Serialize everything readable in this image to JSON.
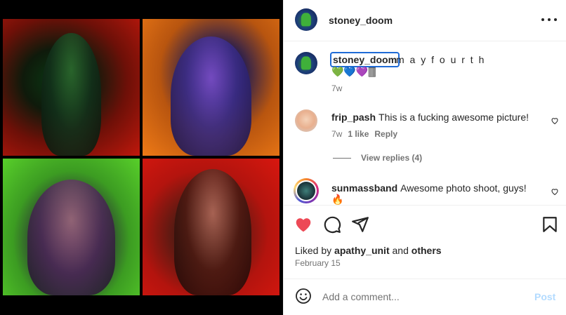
{
  "post": {
    "username": "stoney_doom",
    "caption_text": "m a y f o u r t h",
    "caption_emojis": "💚💙💜🀫",
    "caption_age": "7w"
  },
  "comments": [
    {
      "username": "frip_pash",
      "text": "This is a fucking awesome picture!",
      "age": "7w",
      "likes": "1 like",
      "reply_label": "Reply",
      "view_replies": "View replies (4)"
    },
    {
      "username": "sunmassband",
      "text": "Awesome photo shoot, guys!",
      "emoji": "🔥"
    }
  ],
  "likes": {
    "prefix": "Liked by",
    "user": "apathy_unit",
    "and": "and",
    "others": "others"
  },
  "date": "February 15",
  "add_comment": {
    "placeholder": "Add a comment...",
    "post_label": "Post"
  },
  "colors": {
    "like_active": "#ed4956",
    "post_disabled": "#b3dbff",
    "highlight_border": "#1f6bd6"
  },
  "icons": [
    "more-icon",
    "heart-icon",
    "comment-icon",
    "share-icon",
    "bookmark-icon",
    "emoji-icon"
  ]
}
